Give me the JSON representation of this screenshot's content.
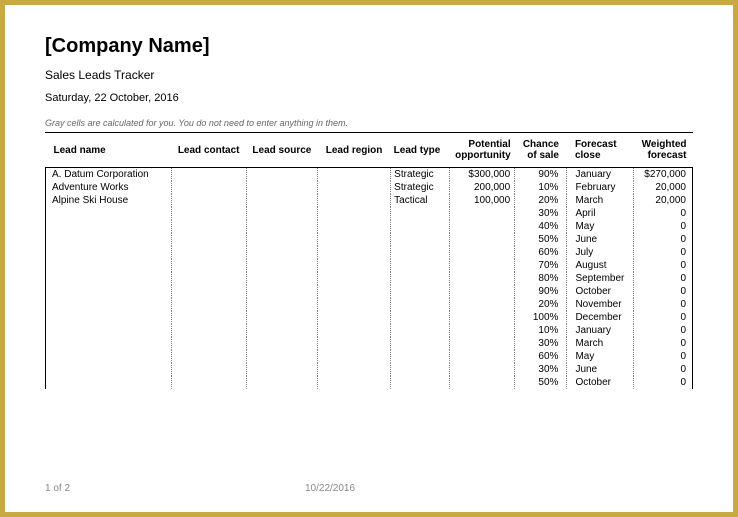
{
  "header": {
    "title": "[Company Name]",
    "subtitle": "Sales Leads Tracker",
    "date": "Saturday, 22 October, 2016",
    "note": "Gray cells are calculated for you. You do not need to enter anything in them."
  },
  "columns": {
    "lead_name": "Lead  name",
    "lead_contact": "Lead  contact",
    "lead_source": "Lead  source",
    "lead_region": "Lead  region",
    "lead_type": "Lead  type",
    "potential": "Potential opportunity",
    "chance": "Chance of sale",
    "forecast_close": "Forecast close",
    "weighted": "Weighted forecast"
  },
  "chart_data": {
    "type": "table",
    "title": "Sales Leads Tracker",
    "columns": [
      "Lead name",
      "Lead contact",
      "Lead source",
      "Lead region",
      "Lead type",
      "Potential opportunity",
      "Chance of sale",
      "Forecast close",
      "Weighted forecast"
    ],
    "rows": [
      {
        "lead_name": "A. Datum Corporation",
        "lead_contact": "",
        "lead_source": "",
        "lead_region": "",
        "lead_type": "Strategic",
        "potential": "$300,000",
        "chance": "90%",
        "forecast_close": "January",
        "weighted": "$270,000"
      },
      {
        "lead_name": "Adventure Works",
        "lead_contact": "",
        "lead_source": "",
        "lead_region": "",
        "lead_type": "Strategic",
        "potential": "200,000",
        "chance": "10%",
        "forecast_close": "February",
        "weighted": "20,000"
      },
      {
        "lead_name": "Alpine Ski House",
        "lead_contact": "",
        "lead_source": "",
        "lead_region": "",
        "lead_type": "Tactical",
        "potential": "100,000",
        "chance": "20%",
        "forecast_close": "March",
        "weighted": "20,000"
      },
      {
        "lead_name": "",
        "lead_contact": "",
        "lead_source": "",
        "lead_region": "",
        "lead_type": "",
        "potential": "",
        "chance": "30%",
        "forecast_close": "April",
        "weighted": "0"
      },
      {
        "lead_name": "",
        "lead_contact": "",
        "lead_source": "",
        "lead_region": "",
        "lead_type": "",
        "potential": "",
        "chance": "40%",
        "forecast_close": "May",
        "weighted": "0"
      },
      {
        "lead_name": "",
        "lead_contact": "",
        "lead_source": "",
        "lead_region": "",
        "lead_type": "",
        "potential": "",
        "chance": "50%",
        "forecast_close": "June",
        "weighted": "0"
      },
      {
        "lead_name": "",
        "lead_contact": "",
        "lead_source": "",
        "lead_region": "",
        "lead_type": "",
        "potential": "",
        "chance": "60%",
        "forecast_close": "July",
        "weighted": "0"
      },
      {
        "lead_name": "",
        "lead_contact": "",
        "lead_source": "",
        "lead_region": "",
        "lead_type": "",
        "potential": "",
        "chance": "70%",
        "forecast_close": "August",
        "weighted": "0"
      },
      {
        "lead_name": "",
        "lead_contact": "",
        "lead_source": "",
        "lead_region": "",
        "lead_type": "",
        "potential": "",
        "chance": "80%",
        "forecast_close": "September",
        "weighted": "0"
      },
      {
        "lead_name": "",
        "lead_contact": "",
        "lead_source": "",
        "lead_region": "",
        "lead_type": "",
        "potential": "",
        "chance": "90%",
        "forecast_close": "October",
        "weighted": "0"
      },
      {
        "lead_name": "",
        "lead_contact": "",
        "lead_source": "",
        "lead_region": "",
        "lead_type": "",
        "potential": "",
        "chance": "20%",
        "forecast_close": "November",
        "weighted": "0"
      },
      {
        "lead_name": "",
        "lead_contact": "",
        "lead_source": "",
        "lead_region": "",
        "lead_type": "",
        "potential": "",
        "chance": "100%",
        "forecast_close": "December",
        "weighted": "0"
      },
      {
        "lead_name": "",
        "lead_contact": "",
        "lead_source": "",
        "lead_region": "",
        "lead_type": "",
        "potential": "",
        "chance": "10%",
        "forecast_close": "January",
        "weighted": "0"
      },
      {
        "lead_name": "",
        "lead_contact": "",
        "lead_source": "",
        "lead_region": "",
        "lead_type": "",
        "potential": "",
        "chance": "30%",
        "forecast_close": "March",
        "weighted": "0"
      },
      {
        "lead_name": "",
        "lead_contact": "",
        "lead_source": "",
        "lead_region": "",
        "lead_type": "",
        "potential": "",
        "chance": "60%",
        "forecast_close": "May",
        "weighted": "0"
      },
      {
        "lead_name": "",
        "lead_contact": "",
        "lead_source": "",
        "lead_region": "",
        "lead_type": "",
        "potential": "",
        "chance": "30%",
        "forecast_close": "June",
        "weighted": "0"
      },
      {
        "lead_name": "",
        "lead_contact": "",
        "lead_source": "",
        "lead_region": "",
        "lead_type": "",
        "potential": "",
        "chance": "50%",
        "forecast_close": "October",
        "weighted": "0"
      }
    ]
  },
  "footer": {
    "page": "1 of 2",
    "date": "10/22/2016"
  }
}
